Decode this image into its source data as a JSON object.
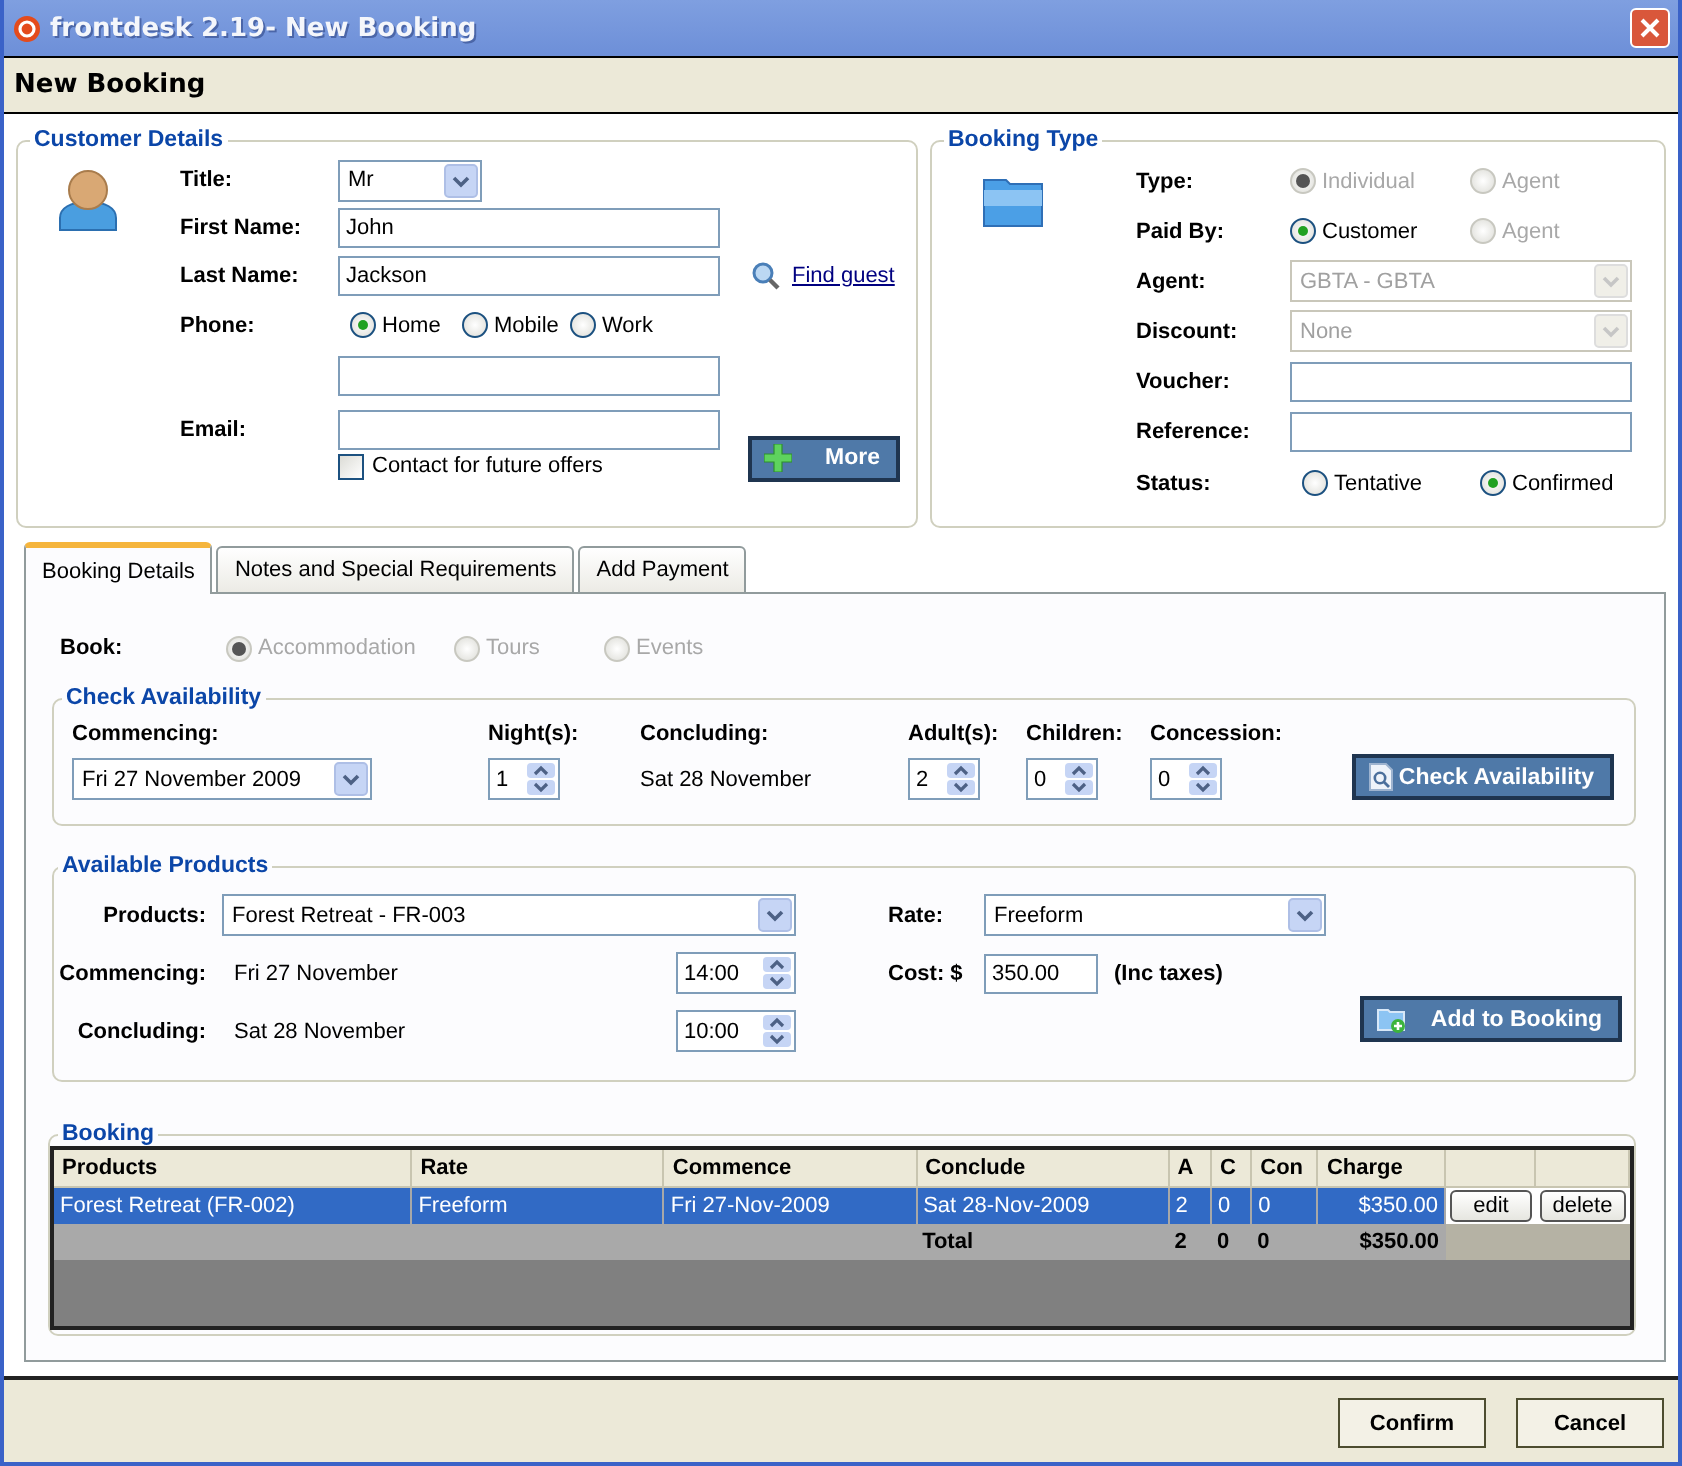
{
  "window": {
    "title": "frontdesk 2.19- New Booking"
  },
  "header": {
    "title": "New Booking"
  },
  "customer_details": {
    "legend": "Customer Details",
    "title": {
      "label": "Title:",
      "value": "Mr"
    },
    "first_name": {
      "label": "First Name:",
      "value": "John"
    },
    "last_name": {
      "label": "Last Name:",
      "value": "Jackson"
    },
    "find_guest": "Find guest",
    "phone": {
      "label": "Phone:",
      "options": [
        {
          "label": "Home",
          "selected": true,
          "disabled": false
        },
        {
          "label": "Mobile",
          "selected": false,
          "disabled": false
        },
        {
          "label": "Work",
          "selected": false,
          "disabled": false
        }
      ]
    },
    "email": {
      "label": "Email:"
    },
    "contact_offers": {
      "label": "Contact for future offers",
      "checked": false
    },
    "more_button": "More"
  },
  "booking_type": {
    "legend": "Booking Type",
    "type": {
      "label": "Type:",
      "options": [
        {
          "label": "Individual",
          "selected": true,
          "disabled": true
        },
        {
          "label": "Agent",
          "selected": false,
          "disabled": true
        }
      ]
    },
    "paid_by": {
      "label": "Paid By:",
      "options": [
        {
          "label": "Customer",
          "selected": true,
          "disabled": false
        },
        {
          "label": "Agent",
          "selected": false,
          "disabled": true
        }
      ]
    },
    "agent": {
      "label": "Agent:",
      "value": "GBTA - GBTA",
      "disabled": true
    },
    "discount": {
      "label": "Discount:",
      "value": "None",
      "disabled": true
    },
    "voucher": {
      "label": "Voucher:"
    },
    "reference": {
      "label": "Reference:"
    },
    "status": {
      "label": "Status:",
      "options": [
        {
          "label": "Tentative",
          "selected": false,
          "disabled": false
        },
        {
          "label": "Confirmed",
          "selected": true,
          "disabled": false
        }
      ]
    }
  },
  "tabs": [
    {
      "label": "Booking Details",
      "selected": true
    },
    {
      "label": "Notes and Special Requirements",
      "selected": false
    },
    {
      "label": "Add Payment",
      "selected": false
    }
  ],
  "book": {
    "label": "Book:",
    "options": [
      {
        "label": "Accommodation",
        "selected": true,
        "disabled": true
      },
      {
        "label": "Tours",
        "selected": false,
        "disabled": true
      },
      {
        "label": "Events",
        "selected": false,
        "disabled": true
      }
    ]
  },
  "check_availability": {
    "legend": "Check Availability",
    "commencing": {
      "label": "Commencing:",
      "value": "Fri 27 November 2009"
    },
    "nights": {
      "label": "Night(s):",
      "value": "1"
    },
    "concluding": {
      "label": "Concluding:",
      "value": "Sat 28 November"
    },
    "adults": {
      "label": "Adult(s):",
      "value": "2"
    },
    "children": {
      "label": "Children:",
      "value": "0"
    },
    "concession": {
      "label": "Concession:",
      "value": "0"
    },
    "button": "Check Availability"
  },
  "available_products": {
    "legend": "Available Products",
    "products": {
      "label": "Products:",
      "value": "Forest Retreat - FR-003"
    },
    "rate": {
      "label": "Rate:",
      "value": "Freeform"
    },
    "commencing": {
      "label": "Commencing:",
      "value": "Fri 27 November",
      "time": "14:00"
    },
    "concluding": {
      "label": "Concluding:",
      "value": "Sat 28 November",
      "time": "10:00"
    },
    "cost": {
      "label": "Cost: $",
      "value": "350.00",
      "note": "(Inc taxes)"
    },
    "button": "Add to Booking"
  },
  "booking": {
    "legend": "Booking",
    "columns": [
      "Products",
      "Rate",
      "Commence",
      "Conclude",
      "A",
      "C",
      "Con",
      "Charge"
    ],
    "rows": [
      {
        "cells": [
          "Forest Retreat (FR-002)",
          "Freeform",
          "Fri 27-Nov-2009",
          "Sat 28-Nov-2009",
          "2",
          "0",
          "0",
          "$350.00"
        ],
        "selected": true,
        "actions": [
          "edit",
          "delete"
        ]
      }
    ],
    "total": {
      "label": "Total",
      "cells": [
        "2",
        "0",
        "0",
        "$350.00"
      ]
    }
  },
  "footer": {
    "buttons": [
      "Confirm",
      "Cancel"
    ]
  }
}
